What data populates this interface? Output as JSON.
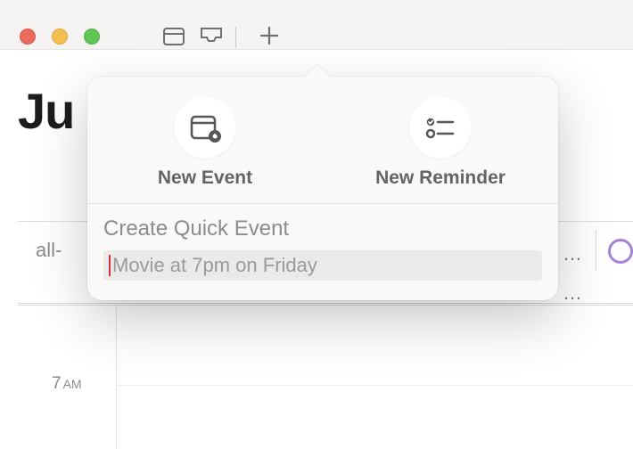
{
  "titlebar": {
    "traffic": {
      "close": "close",
      "minimize": "minimize",
      "fullscreen": "fullscreen"
    },
    "toolbar": {
      "calendars_button": "Calendars",
      "inbox_button": "Inbox",
      "add_button": "Add"
    }
  },
  "main": {
    "month_title_fragment": "Ju",
    "all_day_label_fragment": "all-",
    "time_rows": [
      {
        "hour": "7",
        "ampm": "AM"
      }
    ],
    "event_overflow_1": "…",
    "event_overflow_2": "…"
  },
  "popover": {
    "new_event_label": "New Event",
    "new_reminder_label": "New Reminder",
    "quick_event_label": "Create Quick Event",
    "quick_event_placeholder": "Movie at 7pm on Friday",
    "quick_event_value": ""
  },
  "colors": {
    "accent_purple": "#a783d8",
    "cursor_red": "#d9323a"
  }
}
